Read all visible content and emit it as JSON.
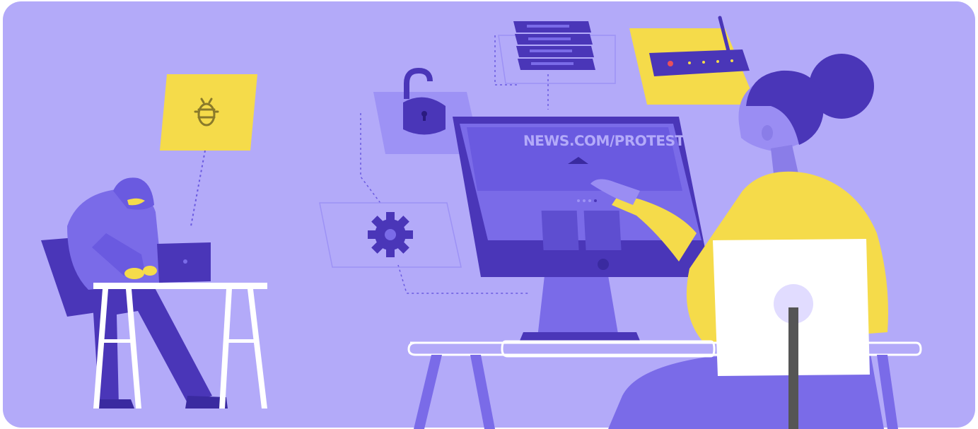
{
  "illustration": {
    "screen_url": "NEWS.COM/PROTESTS",
    "colors": {
      "background": "#b3aaf9",
      "accent_dark": "#4a36b8",
      "accent_mid": "#7a6be8",
      "accent_light": "#9d92f5",
      "yellow": "#f5db4a",
      "white": "#ffffff",
      "skin": "#9a8df3"
    },
    "elements": [
      "hacker-figure",
      "bug-note-icon",
      "laptop",
      "desk-left",
      "padlock-icon",
      "server-rack-icon",
      "router-icon",
      "gear-icon",
      "monitor",
      "woman-figure",
      "chair",
      "desk-right"
    ]
  }
}
